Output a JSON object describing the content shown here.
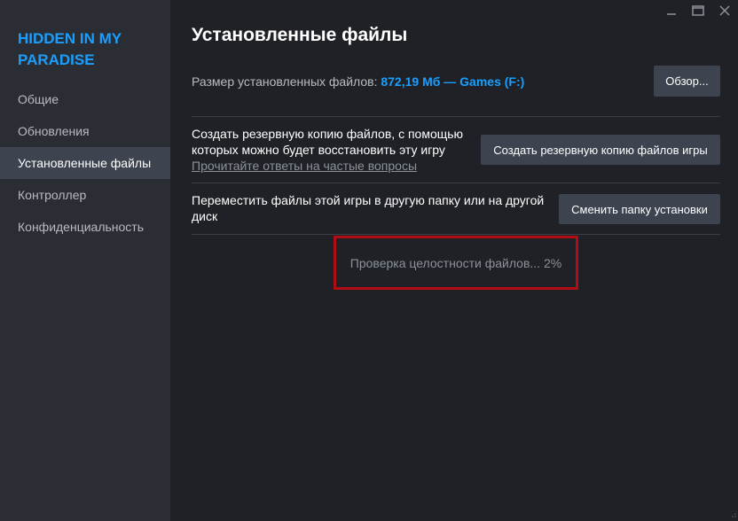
{
  "app": {
    "game_title": "HIDDEN IN MY PARADISE"
  },
  "window_controls": {
    "icons": [
      "minimize-icon",
      "maximize-icon",
      "close-icon"
    ]
  },
  "sidebar": {
    "items": [
      {
        "label": "Общие",
        "active": false
      },
      {
        "label": "Обновления",
        "active": false
      },
      {
        "label": "Установленные файлы",
        "active": true
      },
      {
        "label": "Контроллер",
        "active": false
      },
      {
        "label": "Конфиденциальность",
        "active": false
      }
    ]
  },
  "main": {
    "title": "Установленные файлы",
    "size_row": {
      "label": "Размер установленных файлов: ",
      "value": "872,19 Мб — Games (F:)",
      "browse_button": "Обзор..."
    },
    "backup_row": {
      "text": "Создать резервную копию файлов, с помощью которых можно будет восстановить эту игру",
      "faq_link": "Прочитайте ответы на частые вопросы",
      "button": "Создать резервную копию файлов игры"
    },
    "move_row": {
      "text": "Переместить файлы этой игры в другую папку или на другой диск",
      "button": "Сменить папку установки"
    },
    "verify": {
      "status": "Проверка целостности файлов... 2%",
      "progress_percent": 2
    }
  },
  "colors": {
    "accent": "#1a9fff",
    "highlight_border": "#b00e13",
    "sidebar_bg": "#2a2d34",
    "main_bg": "#1f2126",
    "button_bg": "#3d4450"
  }
}
